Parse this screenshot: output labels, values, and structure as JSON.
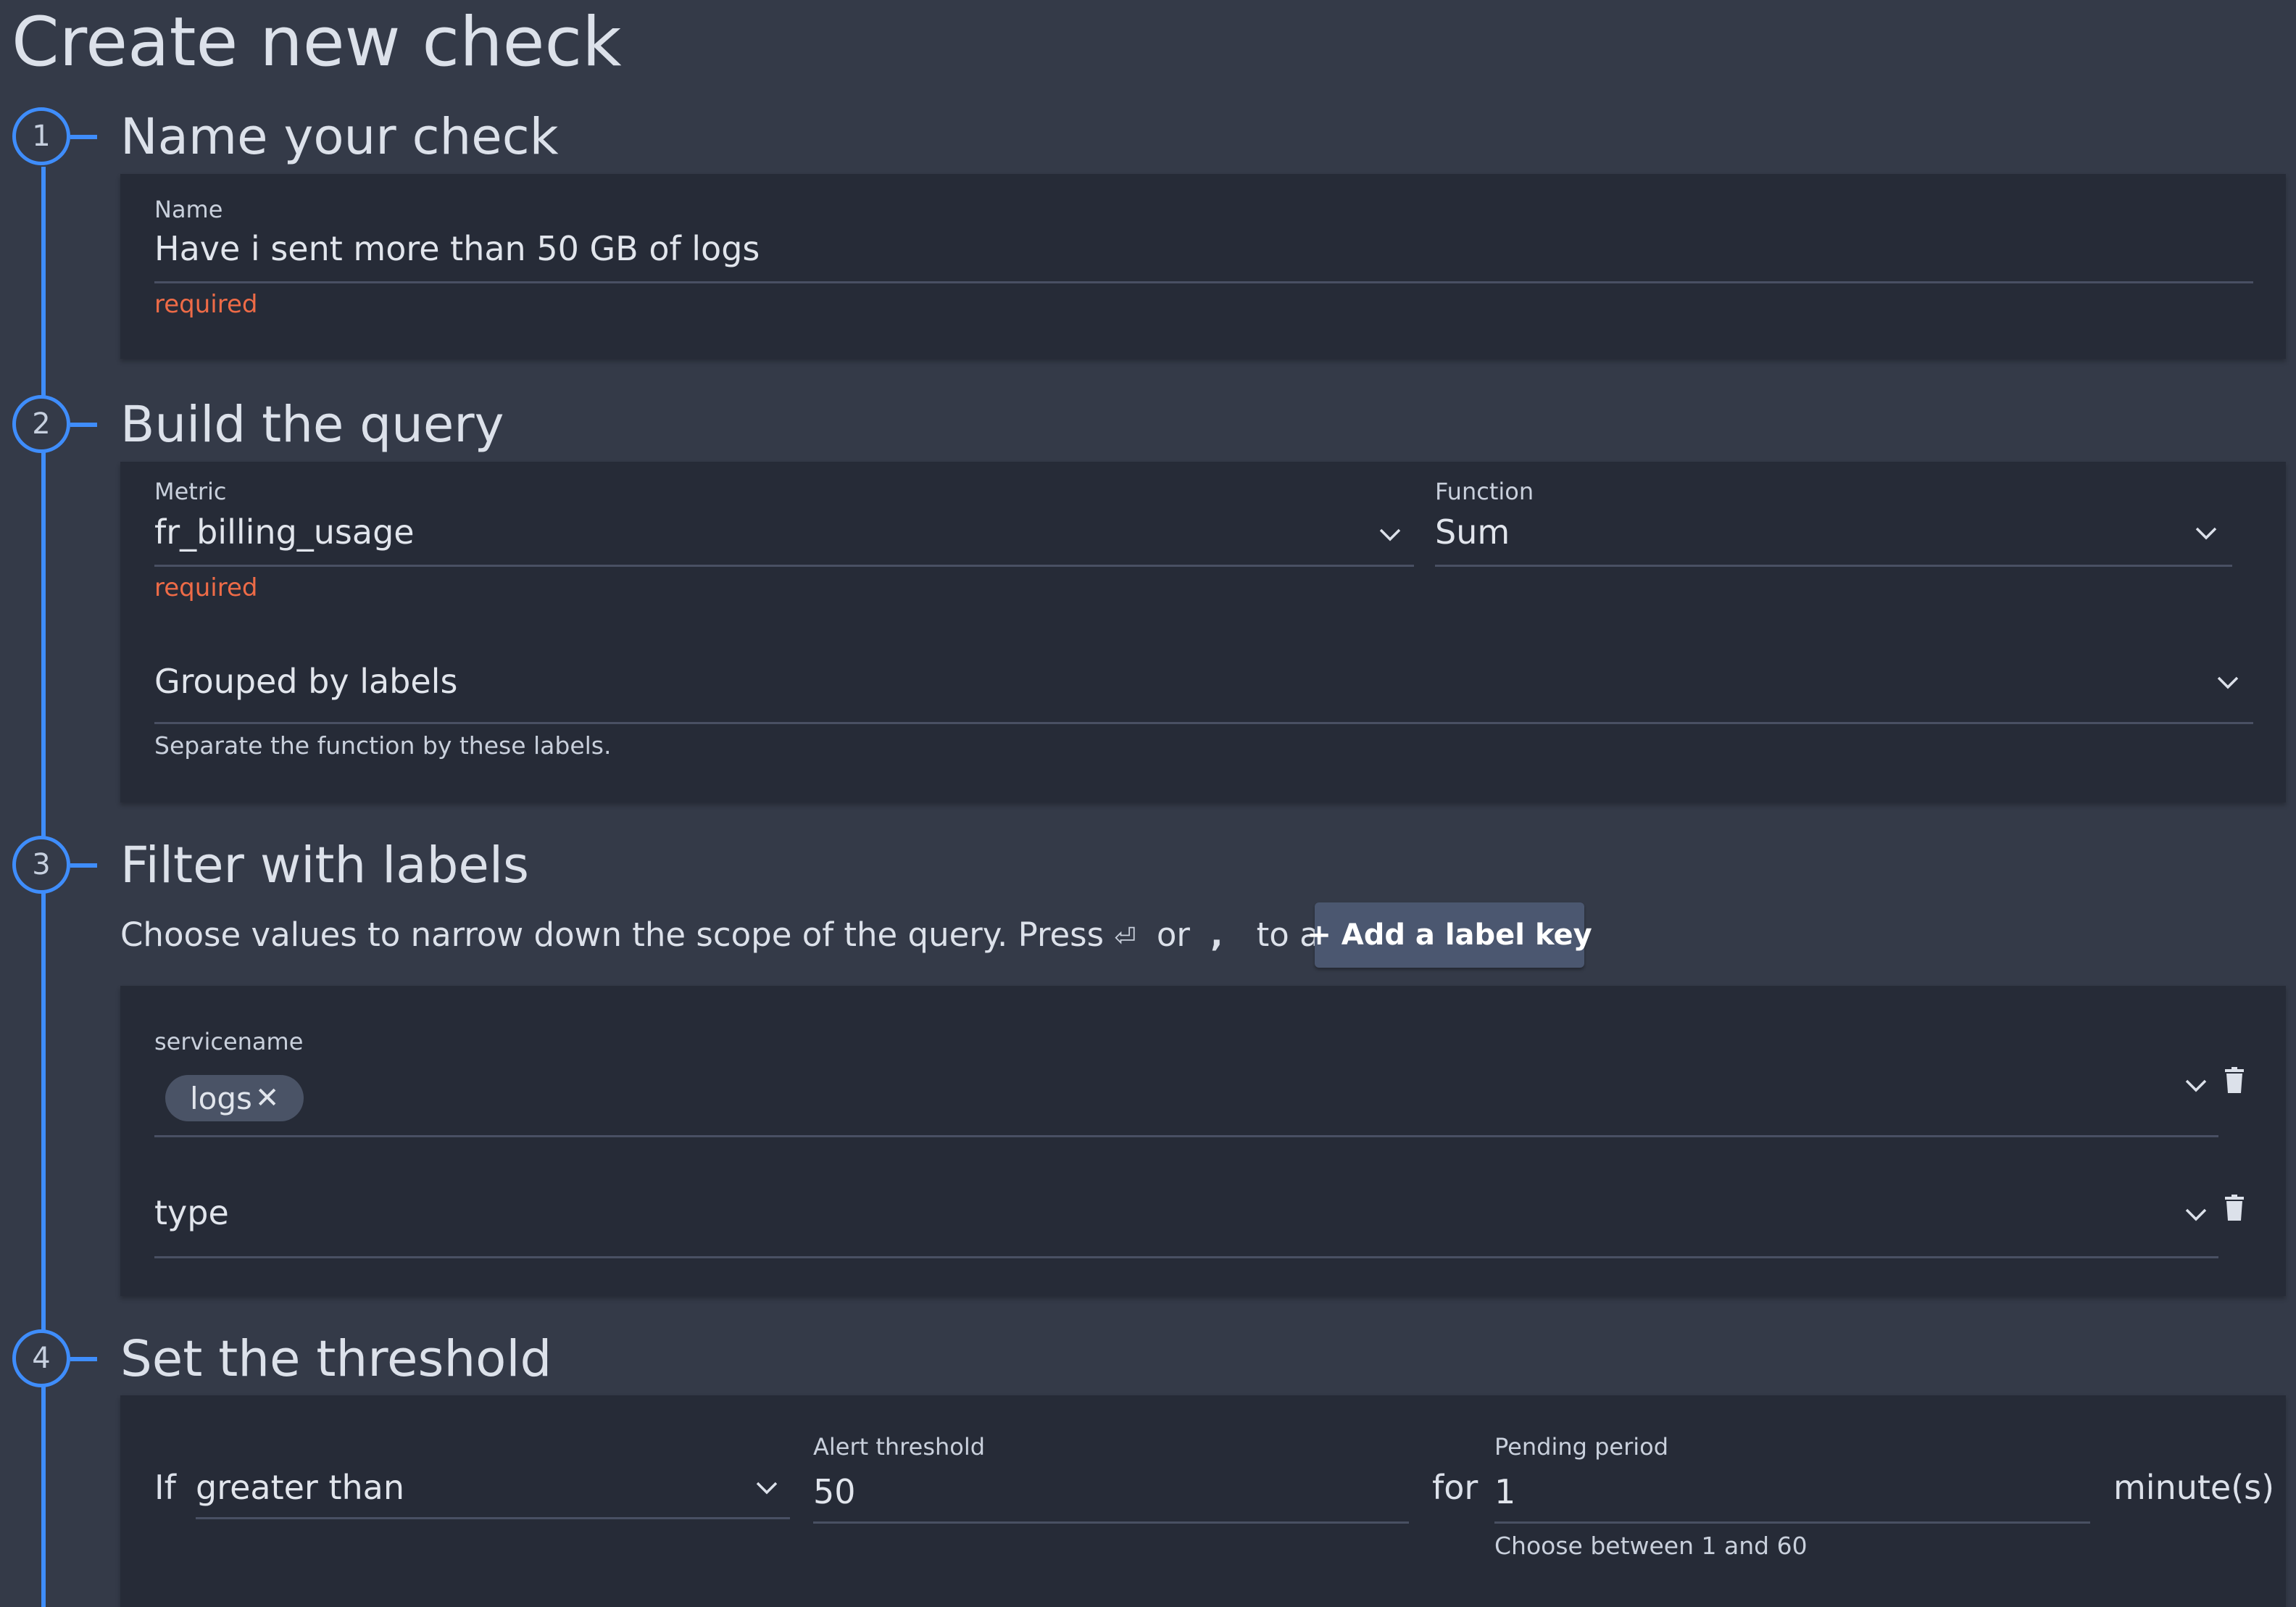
{
  "page": {
    "title": "Create new check"
  },
  "steps": [
    {
      "number": "1",
      "title": "Name your check"
    },
    {
      "number": "2",
      "title": "Build the query"
    },
    {
      "number": "3",
      "title": "Filter with labels"
    },
    {
      "number": "4",
      "title": "Set the threshold"
    }
  ],
  "name_section": {
    "label": "Name",
    "value": "Have i sent more than 50 GB of logs",
    "required": "required"
  },
  "query_section": {
    "metric_label": "Metric",
    "metric_value": "fr_billing_usage",
    "metric_required": "required",
    "function_label": "Function",
    "function_value": "Sum",
    "grouped_placeholder": "Grouped by labels",
    "grouped_helper": "Separate the function by these labels."
  },
  "filter_section": {
    "description_before": "Choose values to narrow down the scope of the query. Press",
    "enter_glyph": "⏎",
    "description_or": "or",
    "comma_glyph": ",",
    "description_after": "to add them.",
    "add_button": "+ Add a label key",
    "filters": [
      {
        "key": "servicename",
        "chips": [
          "logs"
        ]
      },
      {
        "key": "type",
        "chips": []
      }
    ],
    "chip_close": "✕"
  },
  "threshold_section": {
    "if_label": "If",
    "condition_value": "greater than",
    "alert_label": "Alert threshold",
    "alert_value": "50",
    "for_label": "for",
    "pending_label": "Pending period",
    "pending_value": "1",
    "pending_helper": "Choose between 1 and 60",
    "unit": "minute(s)"
  },
  "colors": {
    "background": "#343a48",
    "panel": "#262b37",
    "accent_blue": "#3f8dfb",
    "required_red": "#ee6b47",
    "button": "#4b5770"
  },
  "icons": {
    "dropdown": "chevron-down-icon",
    "delete": "trash-icon"
  }
}
